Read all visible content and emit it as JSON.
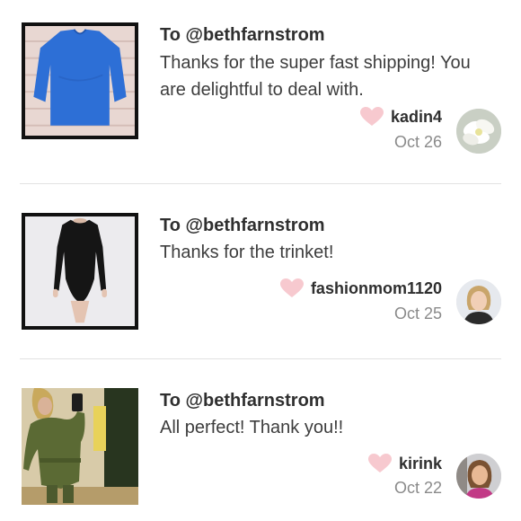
{
  "accent_color": "#f7c9cf",
  "feed": [
    {
      "recipient": "To @bethfarnstrom",
      "message": "Thanks for the super fast shipping! You are delightful to deal with.",
      "username": "kadin4",
      "date": "Oct 26",
      "thumbnail_icon": "blue-sweater-photo",
      "avatar_icon": "white-flower-avatar"
    },
    {
      "recipient": "To @bethfarnstrom",
      "message": "Thanks for the trinket!",
      "username": "fashionmom1120",
      "date": "Oct 25",
      "thumbnail_icon": "black-bodysuit-photo",
      "avatar_icon": "woman-portrait-avatar"
    },
    {
      "recipient": "To @bethfarnstrom",
      "message": "All perfect! Thank you!!",
      "username": "kirink",
      "date": "Oct 22",
      "thumbnail_icon": "olive-jacket-mirror-selfie-photo",
      "avatar_icon": "woman-smiling-avatar"
    }
  ]
}
